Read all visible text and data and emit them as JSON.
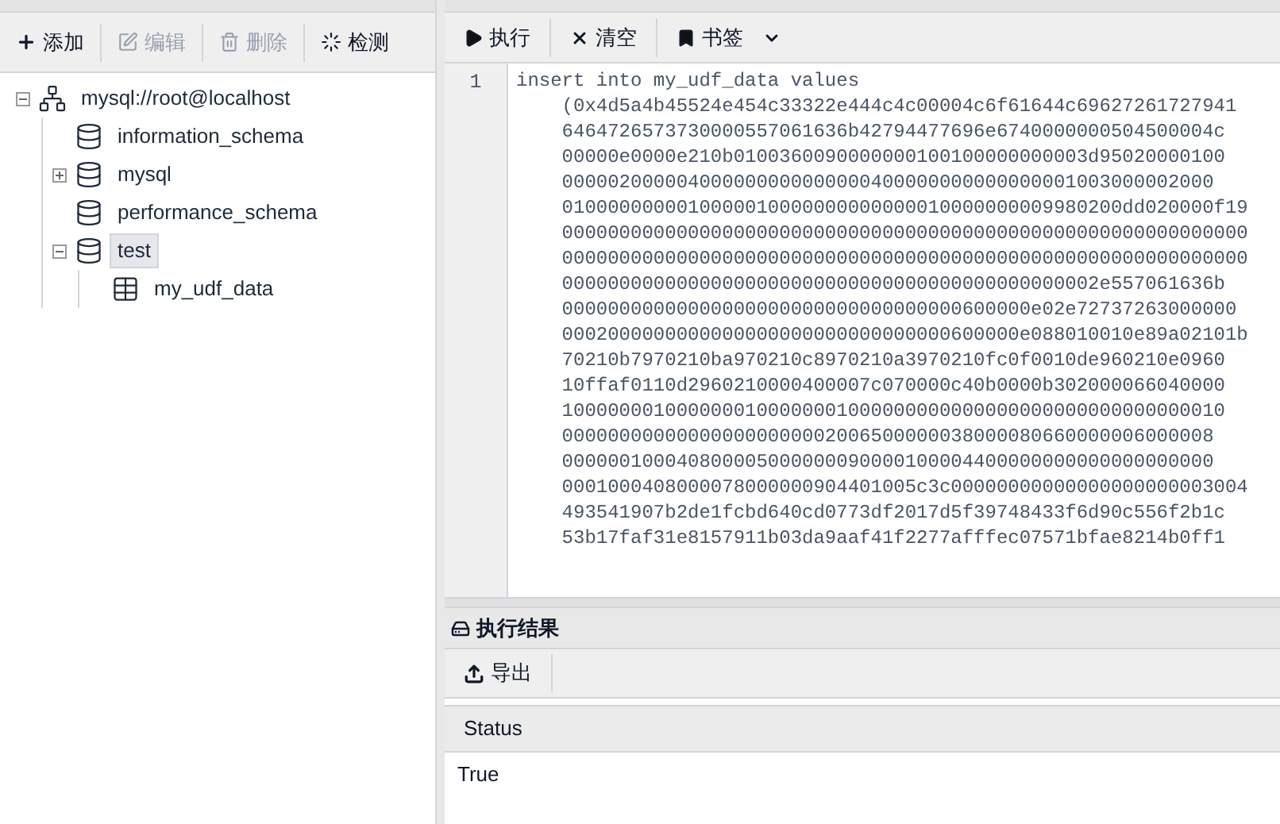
{
  "left_toolbar": [
    {
      "kind": "add",
      "label": "添加",
      "disabled": false
    },
    {
      "kind": "edit",
      "label": "编辑",
      "disabled": true
    },
    {
      "kind": "delete",
      "label": "删除",
      "disabled": true
    },
    {
      "kind": "check",
      "label": "检测",
      "disabled": false
    }
  ],
  "tree": [
    {
      "kind": "server",
      "label": "mysql://root@localhost",
      "expanded": true,
      "selected": false,
      "children": [
        {
          "kind": "database",
          "label": "information_schema",
          "selected": false
        },
        {
          "kind": "database",
          "label": "mysql",
          "expanded": false,
          "selected": false
        },
        {
          "kind": "database",
          "label": "performance_schema",
          "selected": false
        },
        {
          "kind": "database",
          "label": "test",
          "expanded": true,
          "selected": true,
          "children": [
            {
              "kind": "table",
              "label": "my_udf_data",
              "selected": false
            }
          ]
        }
      ]
    }
  ],
  "sql_toolbar": [
    {
      "kind": "run",
      "label": "执行"
    },
    {
      "kind": "clear",
      "label": "清空"
    },
    {
      "kind": "bookmark",
      "label": "书签"
    }
  ],
  "editor": {
    "line_number": "1",
    "lines": [
      "insert into my_udf_data values",
      "    (0x4d5a4b45524e454c33322e444c4c00004c6f61644c69627261727941",
      "    6464726573730000557061636b42794477696e6740000000504500004c",
      "    00000e0000e210b0100360090000000100100000000003d95020000100",
      "    000002000004000000000000000400000000000000001003000002000",
      "    0100000000010000010000000000000010000000009980200dd020000f19",
      "    000000000000000000000000000000000000000000000000000000000000",
      "    000000000000000000000000000000000000000000000000000000000000",
      "    00000000000000000000000000000000000000000000002e557061636b",
      "    00000000000000000000000000000000000600000e02e72737263000000",
      "    0002000000000000000000000000000000600000e088010010e89a02101b",
      "    70210b7970210ba970210c8970210a3970210fc0f0010de960210e0960",
      "    10ffaf0110d2960210000400007c070000c40b0000b302000066040000",
      "    1000000010000000100000001000000000000000000000000000000010",
      "    000000000000000000000002006500000038000080660000006000008",
      "    000000100040800005000000090000100004400000000000000000000",
      "    0001000408000078000000904401005c3c00000000000000000000003004",
      "    493541907b2de1fcbd640cd0773df2017d5f39748433f6d90c556f2b1c",
      "    53b17faf31e8157911b03da9aaf41f2277afffec07571bfae8214b0ff1"
    ]
  },
  "result": {
    "title": "执行结果",
    "export_label": "导出",
    "columns": [
      "Status"
    ],
    "rows": [
      [
        "True"
      ]
    ]
  }
}
